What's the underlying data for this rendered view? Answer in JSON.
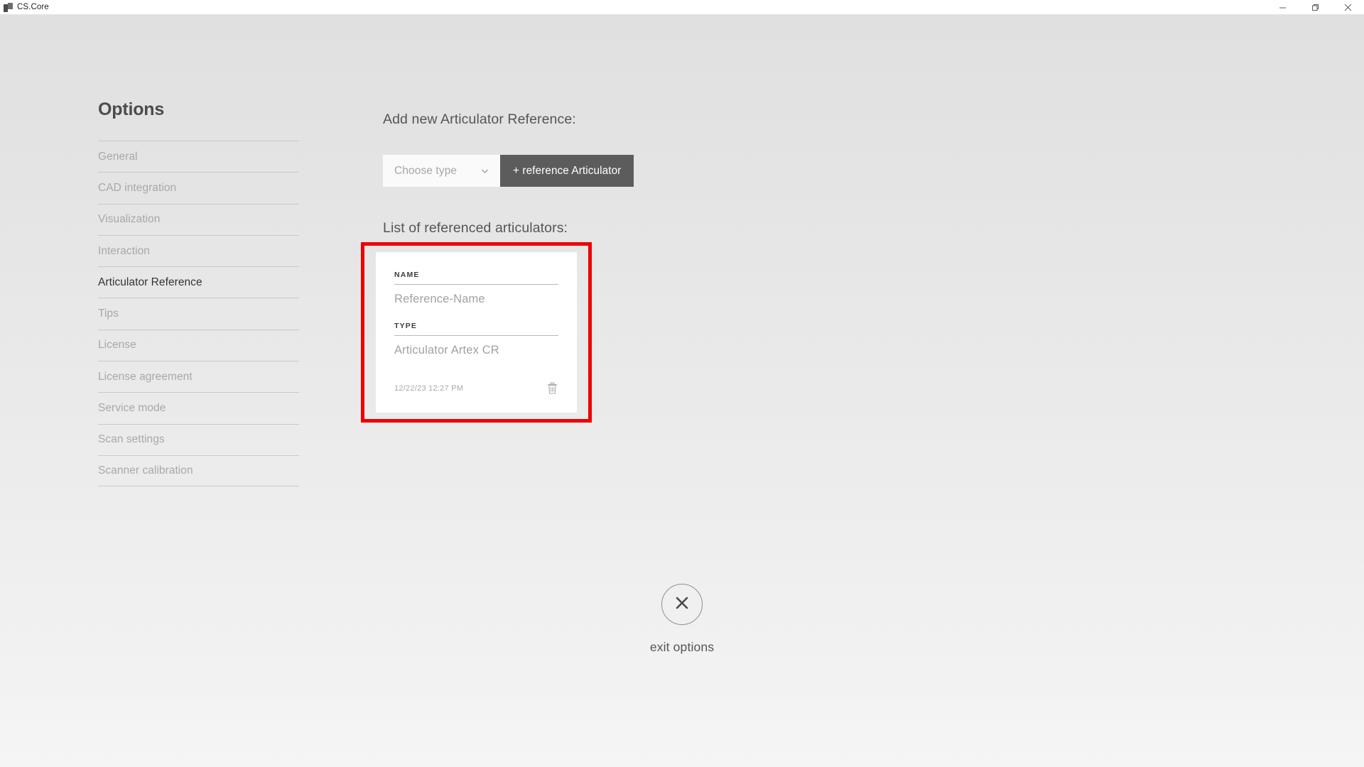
{
  "titlebar": {
    "app_name": "CS.Core",
    "app_icon": "app-logo-icon",
    "minimize_label": "Minimize",
    "restore_label": "Restore",
    "close_label": "Close"
  },
  "sidebar": {
    "title": "Options",
    "items": [
      {
        "label": "General",
        "active": false
      },
      {
        "label": "CAD integration",
        "active": false
      },
      {
        "label": "Visualization",
        "active": false
      },
      {
        "label": "Interaction",
        "active": false
      },
      {
        "label": "Articulator Reference",
        "active": true
      },
      {
        "label": "Tips",
        "active": false
      },
      {
        "label": "License",
        "active": false
      },
      {
        "label": "License agreement",
        "active": false
      },
      {
        "label": "Service mode",
        "active": false
      },
      {
        "label": "Scan settings",
        "active": false
      },
      {
        "label": "Scanner calibration",
        "active": false
      }
    ]
  },
  "main": {
    "add_heading": "Add new Articulator Reference:",
    "type_select": {
      "value": "Choose type",
      "icon": "chevron-down-icon"
    },
    "add_button": "+ reference Articulator",
    "list_heading": "List of referenced articulators:",
    "cards": [
      {
        "name_label": "NAME",
        "name_value": "Reference-Name",
        "type_label": "TYPE",
        "type_value": "Articulator Artex CR",
        "timestamp": "12/22/23 12:27 PM",
        "delete_icon": "trash-icon"
      }
    ]
  },
  "exit": {
    "icon": "close-x-icon",
    "label": "exit options"
  },
  "colors": {
    "accent_button": "#5c5c5c",
    "highlight_box": "#ee0000",
    "active_nav_text": "#333333",
    "inactive_nav_text": "#a8a8a8",
    "card_background": "#ffffff"
  }
}
